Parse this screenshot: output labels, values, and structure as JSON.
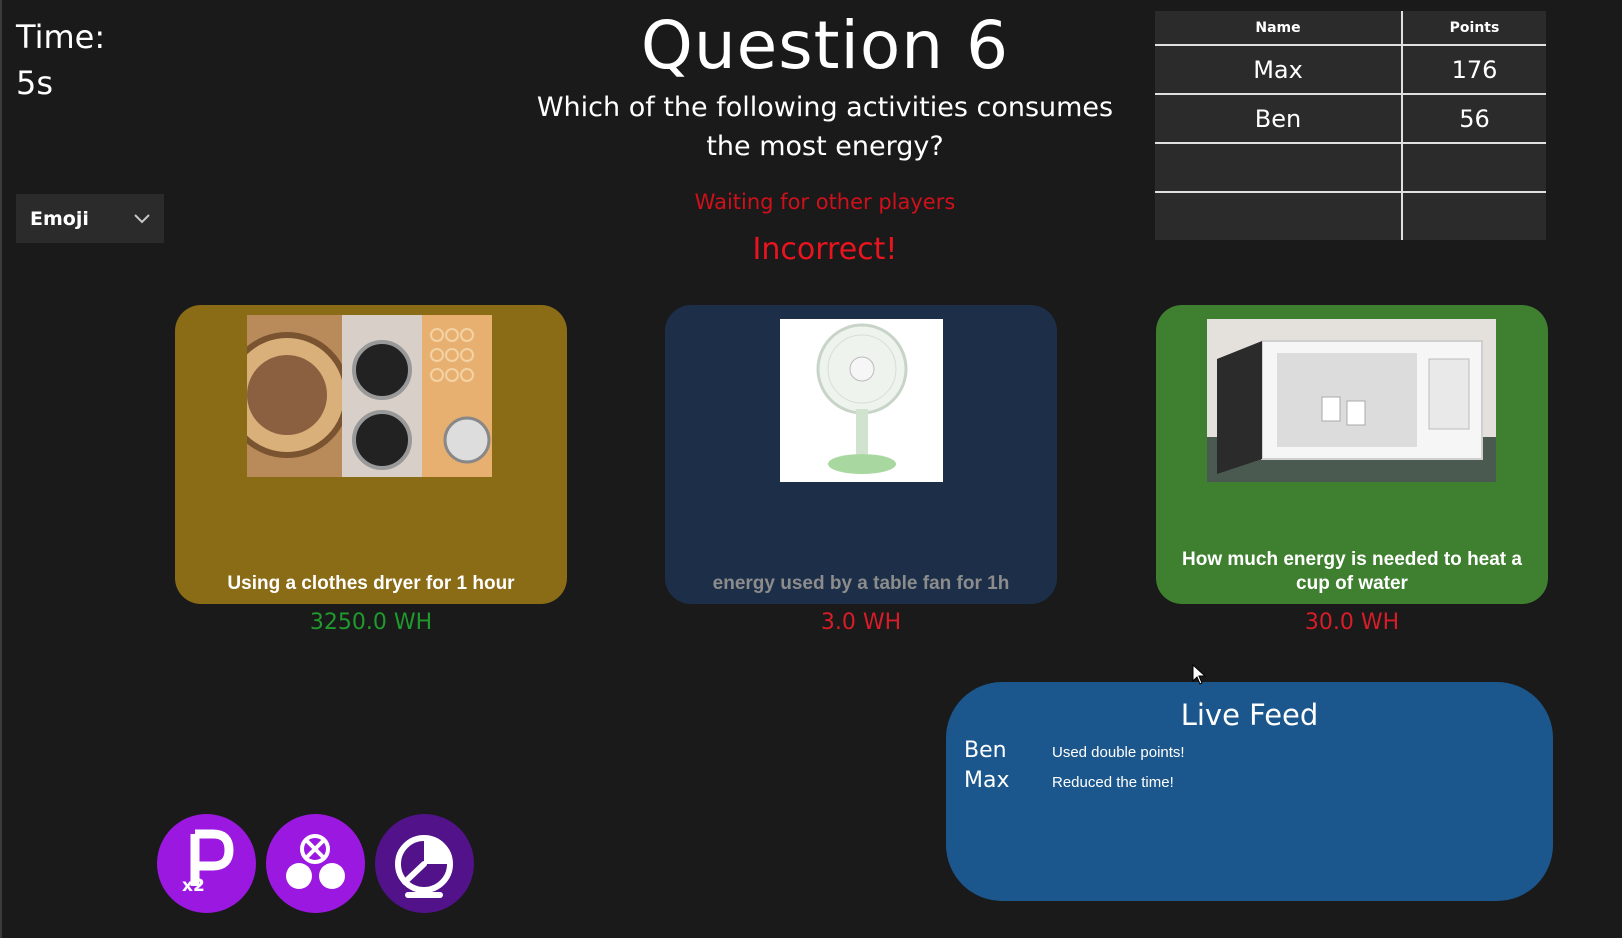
{
  "timer": {
    "label": "Time:",
    "value": "5s"
  },
  "emoji_dropdown": {
    "selected": "Emoji"
  },
  "question": {
    "title": "Question 6",
    "text_line1": "Which of the following activities consumes",
    "text_line2": "the most energy?",
    "status": "Waiting for other players",
    "result": "Incorrect!"
  },
  "scoreboard": {
    "headers": [
      "Name",
      "Points"
    ],
    "rows": [
      {
        "name": "Max",
        "points": "176"
      },
      {
        "name": "Ben",
        "points": "56"
      },
      {
        "name": "",
        "points": ""
      },
      {
        "name": "",
        "points": ""
      }
    ]
  },
  "answers": [
    {
      "label": "Using a clothes dryer for 1 hour",
      "value": "3250.0 WH",
      "card_color": "#8a6c16",
      "value_color": "#1f9a2c",
      "image": "clothes-dryer-image"
    },
    {
      "label": "energy used by a table fan for 1h",
      "value": "3.0 WH",
      "card_color": "#1c2e48",
      "value_color": "#d81c28",
      "image": "table-fan-image"
    },
    {
      "label": "How much energy is needed to heat a cup of water",
      "value": "30.0 WH",
      "card_color": "#3f8030",
      "value_color": "#d81c28",
      "image": "microwave-image"
    }
  ],
  "live_feed": {
    "title": "Live Feed",
    "entries": [
      {
        "player": "Ben",
        "action": "Used double points!"
      },
      {
        "player": "Max",
        "action": "Reduced the time!"
      }
    ]
  },
  "powerups": [
    {
      "name": "double-points-icon",
      "color": "#9b18e0"
    },
    {
      "name": "remove-answers-icon",
      "color": "#9b18e0"
    },
    {
      "name": "reduce-time-icon",
      "color": "#52128a"
    }
  ]
}
